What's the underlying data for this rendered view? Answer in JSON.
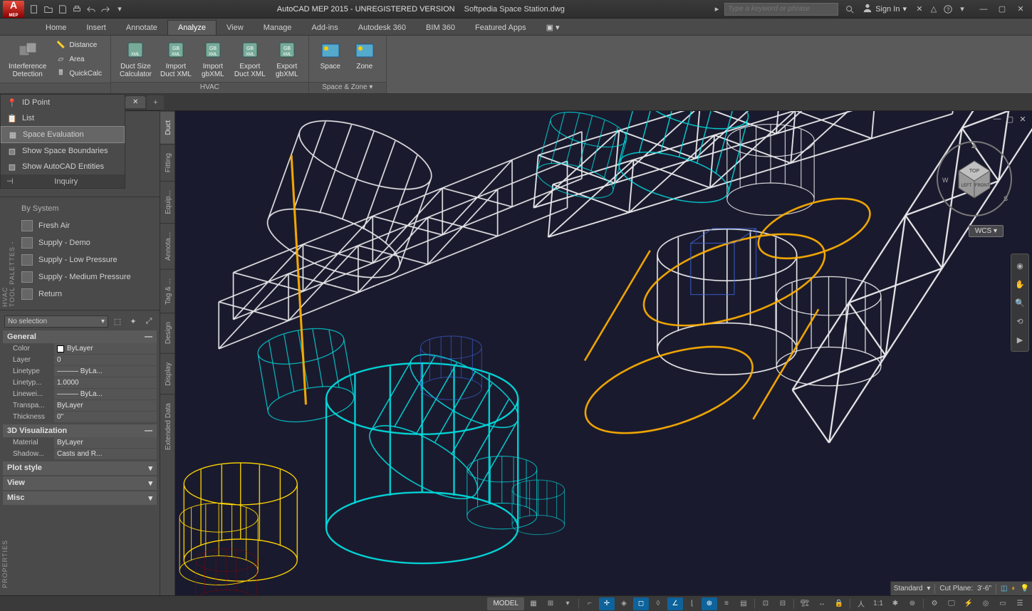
{
  "title": {
    "app": "AutoCAD MEP 2015 - UNREGISTERED VERSION",
    "file": "Softpedia Space Station.dwg"
  },
  "search": {
    "placeholder": "Type a keyword or phrase"
  },
  "signin": {
    "label": "Sign In"
  },
  "tabs": [
    "Home",
    "Insert",
    "Annotate",
    "Analyze",
    "View",
    "Manage",
    "Add-ins",
    "Autodesk 360",
    "BIM 360",
    "Featured Apps"
  ],
  "active_tab": "Analyze",
  "ribbon": {
    "g1": {
      "big": "Interference\nDetection",
      "minis": [
        "Distance",
        "Area",
        "QuickCalc"
      ],
      "label": ""
    },
    "g2": {
      "btns": [
        "Duct Size\nCalculator",
        "Import\nDuct XML",
        "Import\ngbXML",
        "Export\nDuct XML",
        "Export\ngbXML"
      ],
      "label": "HVAC"
    },
    "g3": {
      "btns": [
        "Space",
        "Zone"
      ],
      "label": "Space & Zone ▾"
    }
  },
  "inquiry": {
    "items": [
      "ID Point",
      "List",
      "Space Evaluation",
      "Show Space Boundaries",
      "Show AutoCAD Entities"
    ],
    "footer": "Inquiry"
  },
  "palette": {
    "header": "By System",
    "items": [
      "Fresh Air",
      "Supply - Demo",
      "Supply - Low Pressure",
      "Supply - Medium Pressure",
      "Return"
    ],
    "vert_label": "TOOL PALETTES - HVAC"
  },
  "vtabs": [
    "Duct",
    "Fitting",
    "Equip...",
    "Annota...",
    "Tag & ...",
    "Design",
    "Display",
    "Extended Data"
  ],
  "props": {
    "selector": "No selection",
    "sections": {
      "general": {
        "title": "General",
        "rows": [
          {
            "k": "Color",
            "v": "ByLayer",
            "sw": true
          },
          {
            "k": "Layer",
            "v": "0"
          },
          {
            "k": "Linetype",
            "v": "——— ByLa..."
          },
          {
            "k": "Linetyp...",
            "v": "1.0000"
          },
          {
            "k": "Linewei...",
            "v": "——— ByLa..."
          },
          {
            "k": "Transpa...",
            "v": "ByLayer"
          },
          {
            "k": "Thickness",
            "v": "0\""
          }
        ]
      },
      "viz": {
        "title": "3D Visualization",
        "rows": [
          {
            "k": "Material",
            "v": "ByLayer"
          },
          {
            "k": "Shadow...",
            "v": "Casts and R..."
          }
        ]
      }
    },
    "collapsed": [
      "Plot style",
      "View",
      "Misc"
    ],
    "vert_label": "PROPERTIES"
  },
  "viewport": {
    "wcs": "WCS",
    "cube": {
      "top": "TOP",
      "left": "LEFT",
      "front": "FRONT",
      "w": "W",
      "s": "S"
    },
    "footer": {
      "std": "Standard",
      "cut_label": "Cut Plane:",
      "cut_val": "3'-6\""
    }
  },
  "status": {
    "model": "MODEL",
    "scale": "1:1"
  }
}
